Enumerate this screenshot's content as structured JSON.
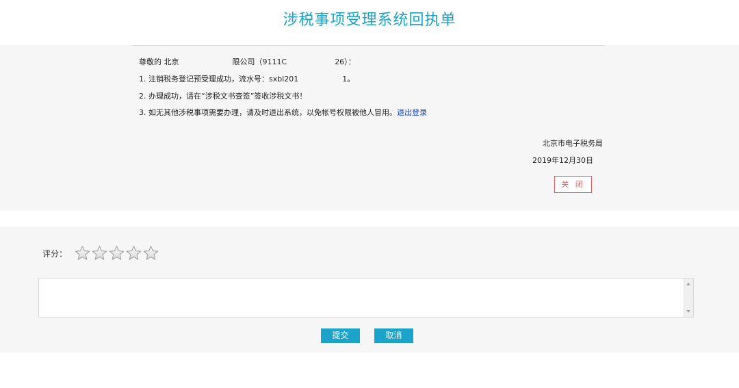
{
  "header": {
    "title": "涉税事项受理系统回执单"
  },
  "receipt": {
    "greeting_prefix": "尊敬的 北京",
    "greeting_company_suffix": "限公司（9111C",
    "greeting_tail": "26）：",
    "line1_prefix": "1. 注销税务登记预受理成功，流水号：sxbl201",
    "line1_suffix": "1。",
    "line2": "2. 办理成功，请在“涉税文书查签”签收涉税文书！",
    "line3": "3. 如无其他涉税事项需要办理，请及时退出系统，以免帐号权限被他人冒用。",
    "logout_link": "退出登录",
    "signing_org": "北京市电子税务局",
    "date": "2019年12月30日",
    "close_button": "关 闭"
  },
  "feedback": {
    "rating_label": "评分：",
    "star_count": 5,
    "stars_selected": 0,
    "comment_value": "",
    "submit_button": "提交",
    "cancel_button": "取消"
  },
  "colors": {
    "accent": "#1ba3c9",
    "link": "#1540d4",
    "close_border": "#e05a5a",
    "panel_bg": "#f6f6f6"
  }
}
